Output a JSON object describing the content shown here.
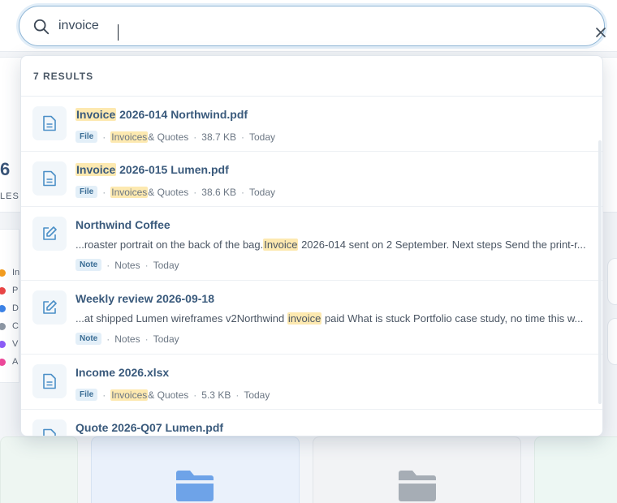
{
  "background": {
    "stat_number": "6",
    "stat_label": "LES",
    "legend_items": [
      {
        "label": "In",
        "color": "#f29c1f"
      },
      {
        "label": "P",
        "color": "#e84545"
      },
      {
        "label": "D",
        "color": "#3b82e6"
      },
      {
        "label": "C",
        "color": "#8c96a3"
      },
      {
        "label": "V",
        "color": "#8b5cf6"
      },
      {
        "label": "A",
        "color": "#ec4899"
      }
    ],
    "folder_colors": {
      "blue": "#6ea3e8",
      "gray": "#a6adb5"
    }
  },
  "search": {
    "value": "invoice",
    "icon": "search-icon",
    "clear_icon": "close-icon"
  },
  "results": {
    "count_label": "7 RESULTS",
    "items": [
      {
        "type_icon": "file-icon",
        "title_highlight": "Invoice",
        "title_rest": " 2026-014 Northwind.pdf",
        "badge": "File",
        "folder_highlight": "Invoices",
        "folder_rest": " & Quotes",
        "size": "38.7 KB",
        "date": "Today"
      },
      {
        "type_icon": "file-icon",
        "title_highlight": "Invoice",
        "title_rest": " 2026-015 Lumen.pdf",
        "badge": "File",
        "folder_highlight": "Invoices",
        "folder_rest": " & Quotes",
        "size": "38.6 KB",
        "date": "Today"
      },
      {
        "type_icon": "edit-note-icon",
        "title": "Northwind Coffee",
        "snippet_before": "...roaster portrait on the back of the bag.",
        "snippet_highlight": "Invoice",
        "snippet_after": " 2026-014 sent on 2 September. Next steps Send the print-r...",
        "badge": "Note",
        "category": "Notes",
        "date": "Today"
      },
      {
        "type_icon": "edit-note-icon",
        "title": "Weekly review 2026-09-18",
        "snippet_before": "...at shipped Lumen wireframes v2Northwind ",
        "snippet_highlight": "invoice",
        "snippet_after": " paid What is stuck Portfolio case study, no time this w...",
        "badge": "Note",
        "category": "Notes",
        "date": "Today"
      },
      {
        "type_icon": "file-icon",
        "title": "Income 2026.xlsx",
        "badge": "File",
        "folder_highlight": "Invoices",
        "folder_rest": " & Quotes",
        "size": "5.3 KB",
        "date": "Today"
      },
      {
        "type_icon": "file-icon",
        "title": "Quote 2026-Q07 Lumen.pdf"
      }
    ]
  }
}
